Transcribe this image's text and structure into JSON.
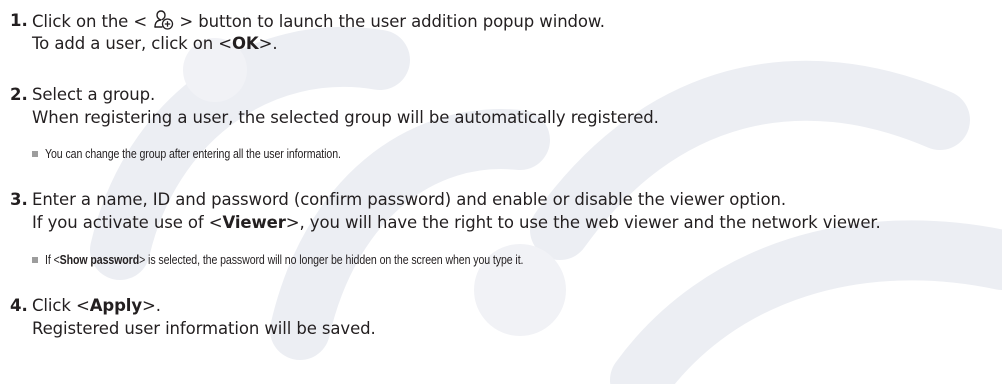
{
  "steps": [
    {
      "number": "1.",
      "line1_a": "Click on the < ",
      "line1_icon": "add-user-icon",
      "line1_b": " > button to launch the user addition popup window.",
      "line2_a": "To add a user, click on <",
      "line2_bold": "OK",
      "line2_b": ">."
    },
    {
      "number": "2.",
      "line1": "Select a group.",
      "line2": "When registering a user, the selected group will be automatically registered.",
      "note": "You can change the group after entering all the user information."
    },
    {
      "number": "3.",
      "line1": "Enter a name, ID and password (confirm password) and enable or disable the viewer option.",
      "line2_a": "If you activate use of <",
      "line2_bold": "Viewer",
      "line2_b": ">, you will have the right to use the web viewer and the network viewer.",
      "note_a": "If <",
      "note_bold": "Show password",
      "note_b": "> is selected, the password will no longer be hidden on the screen when you type it."
    },
    {
      "number": "4.",
      "line1_a": "Click <",
      "line1_bold": "Apply",
      "line1_b": ">.",
      "line2": "Registered user information will be saved."
    }
  ],
  "colors": {
    "text": "#231f20",
    "bullet": "#9d9d9d",
    "watermark": "#eceef3"
  }
}
